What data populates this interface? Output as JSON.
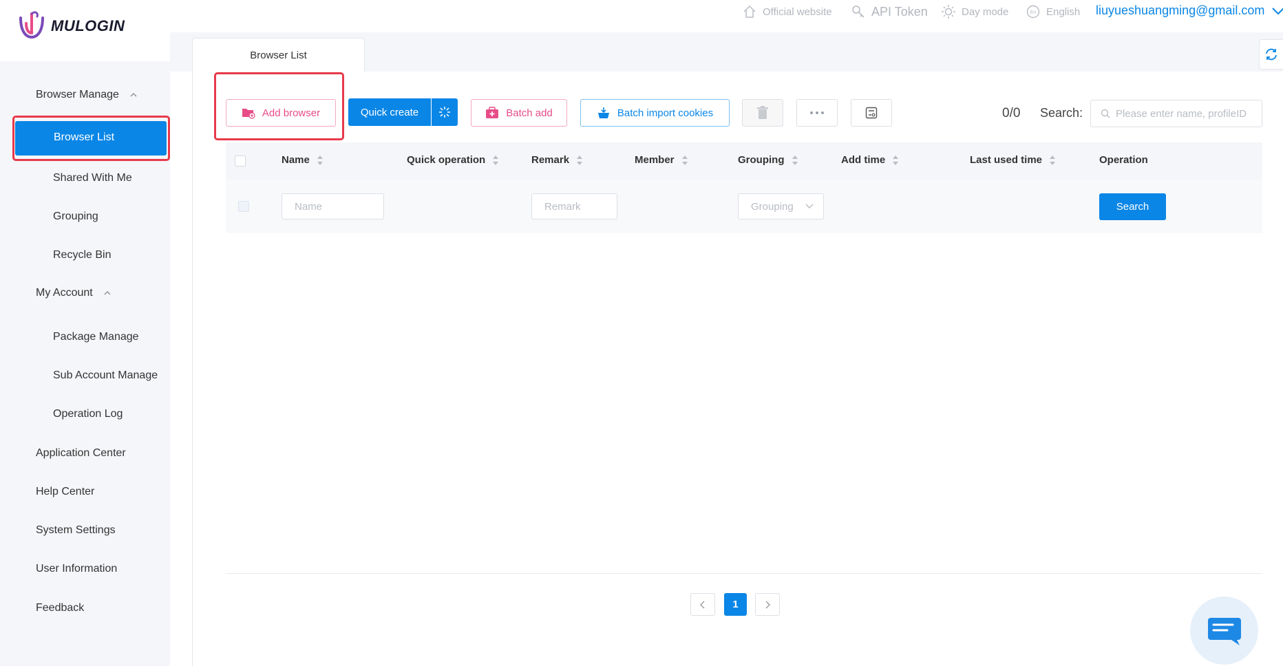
{
  "app": {
    "logo_text": "MULOGIN"
  },
  "topbar": {
    "official_website": "Official website",
    "api_token": "API Token",
    "day_mode": "Day mode",
    "language": "English",
    "user_email": "liuyueshuangming@gmail.com"
  },
  "sidebar": {
    "browser_manage": "Browser Manage",
    "browser_list": "Browser List",
    "shared_with_me": "Shared With Me",
    "grouping": "Grouping",
    "recycle_bin": "Recycle Bin",
    "my_account": "My Account",
    "package_manage": "Package Manage",
    "sub_account_manage": "Sub Account Manage",
    "operation_log": "Operation Log",
    "application_center": "Application Center",
    "help_center": "Help Center",
    "system_settings": "System Settings",
    "user_information": "User Information",
    "feedback": "Feedback"
  },
  "tabs": {
    "active": "Browser List"
  },
  "toolbar": {
    "add_browser": "Add browser",
    "quick_create": "Quick create",
    "batch_add": "Batch add",
    "batch_import_cookies": "Batch import cookies",
    "count": "0/0",
    "search_label": "Search:",
    "search_placeholder": "Please enter name, profileID"
  },
  "table": {
    "columns": {
      "name": "Name",
      "quick_operation": "Quick operation",
      "remark": "Remark",
      "member": "Member",
      "grouping": "Grouping",
      "add_time": "Add time",
      "last_used_time": "Last used time",
      "operation": "Operation"
    },
    "filters": {
      "name_placeholder": "Name",
      "remark_placeholder": "Remark",
      "grouping_placeholder": "Grouping",
      "search_button": "Search"
    }
  },
  "pagination": {
    "current_page": "1"
  },
  "colors": {
    "primary": "#0a86e6",
    "pink": "#e74c88",
    "highlight": "#e8394a",
    "sidebar_bg": "#f4f6f9"
  }
}
